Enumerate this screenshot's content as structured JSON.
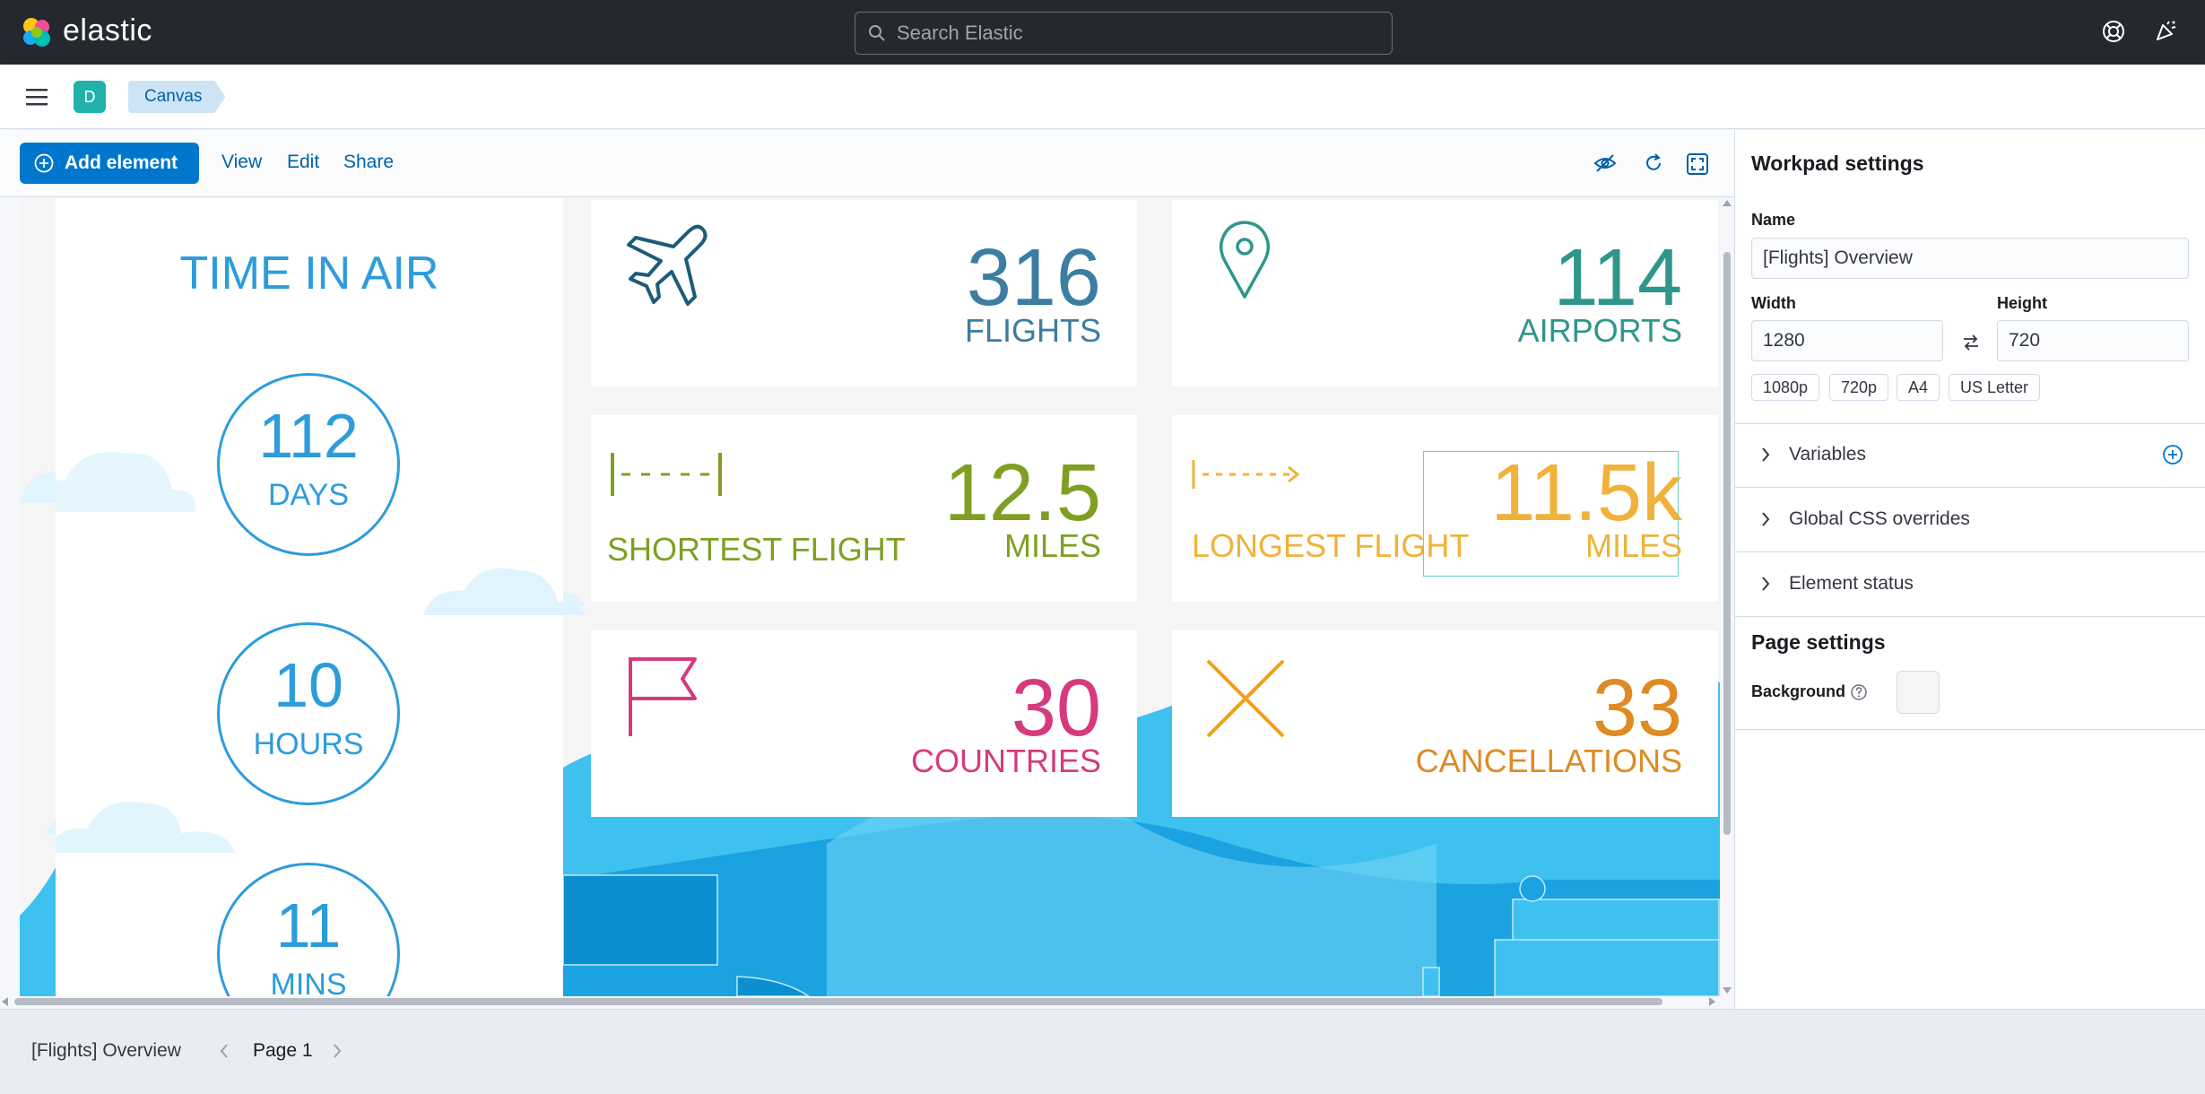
{
  "header": {
    "brand": "elastic",
    "search_placeholder": "Search Elastic"
  },
  "breadcrumb": {
    "avatar": "D",
    "items": [
      "Canvas",
      "[Flights] Overview"
    ]
  },
  "toolbar": {
    "add_element": "Add element",
    "view": "View",
    "edit": "Edit",
    "share": "Share"
  },
  "workpad": {
    "time_in_air": {
      "title": "TIME IN AIR",
      "days": "112",
      "days_unit": "DAYS",
      "hours": "10",
      "hours_unit": "HOURS",
      "mins": "11",
      "mins_unit": "MINS"
    },
    "flights": {
      "value": "316",
      "label": "FLIGHTS",
      "color": "#3b7ea1"
    },
    "airports": {
      "value": "114",
      "label": "AIRPORTS",
      "color": "#2e968a"
    },
    "shortest": {
      "title": "SHORTEST FLIGHT",
      "value": "12.5",
      "label": "MILES",
      "color": "#7f9f22"
    },
    "longest": {
      "title": "LONGEST FLIGHT",
      "value": "11.5k",
      "label": "MILES",
      "color": "#f0b23a"
    },
    "countries": {
      "value": "30",
      "label": "COUNTRIES",
      "color": "#d63a7d"
    },
    "cancellations": {
      "value": "33",
      "label": "CANCELLATIONS",
      "color": "#de8b23"
    }
  },
  "sidebar": {
    "title": "Workpad settings",
    "name_label": "Name",
    "name_value": "[Flights] Overview",
    "width_label": "Width",
    "width_value": "1280",
    "height_label": "Height",
    "height_value": "720",
    "presets": [
      "1080p",
      "720p",
      "A4",
      "US Letter"
    ],
    "sections": [
      "Variables",
      "Global CSS overrides",
      "Element status"
    ],
    "page_settings_title": "Page settings",
    "background_label": "Background"
  },
  "footer": {
    "workpad_name": "[Flights] Overview",
    "page_label": "Page 1"
  },
  "colors": {
    "accent": "#0077cc",
    "header_bg": "#25282f",
    "sky_blue": "#2d9cdb"
  }
}
